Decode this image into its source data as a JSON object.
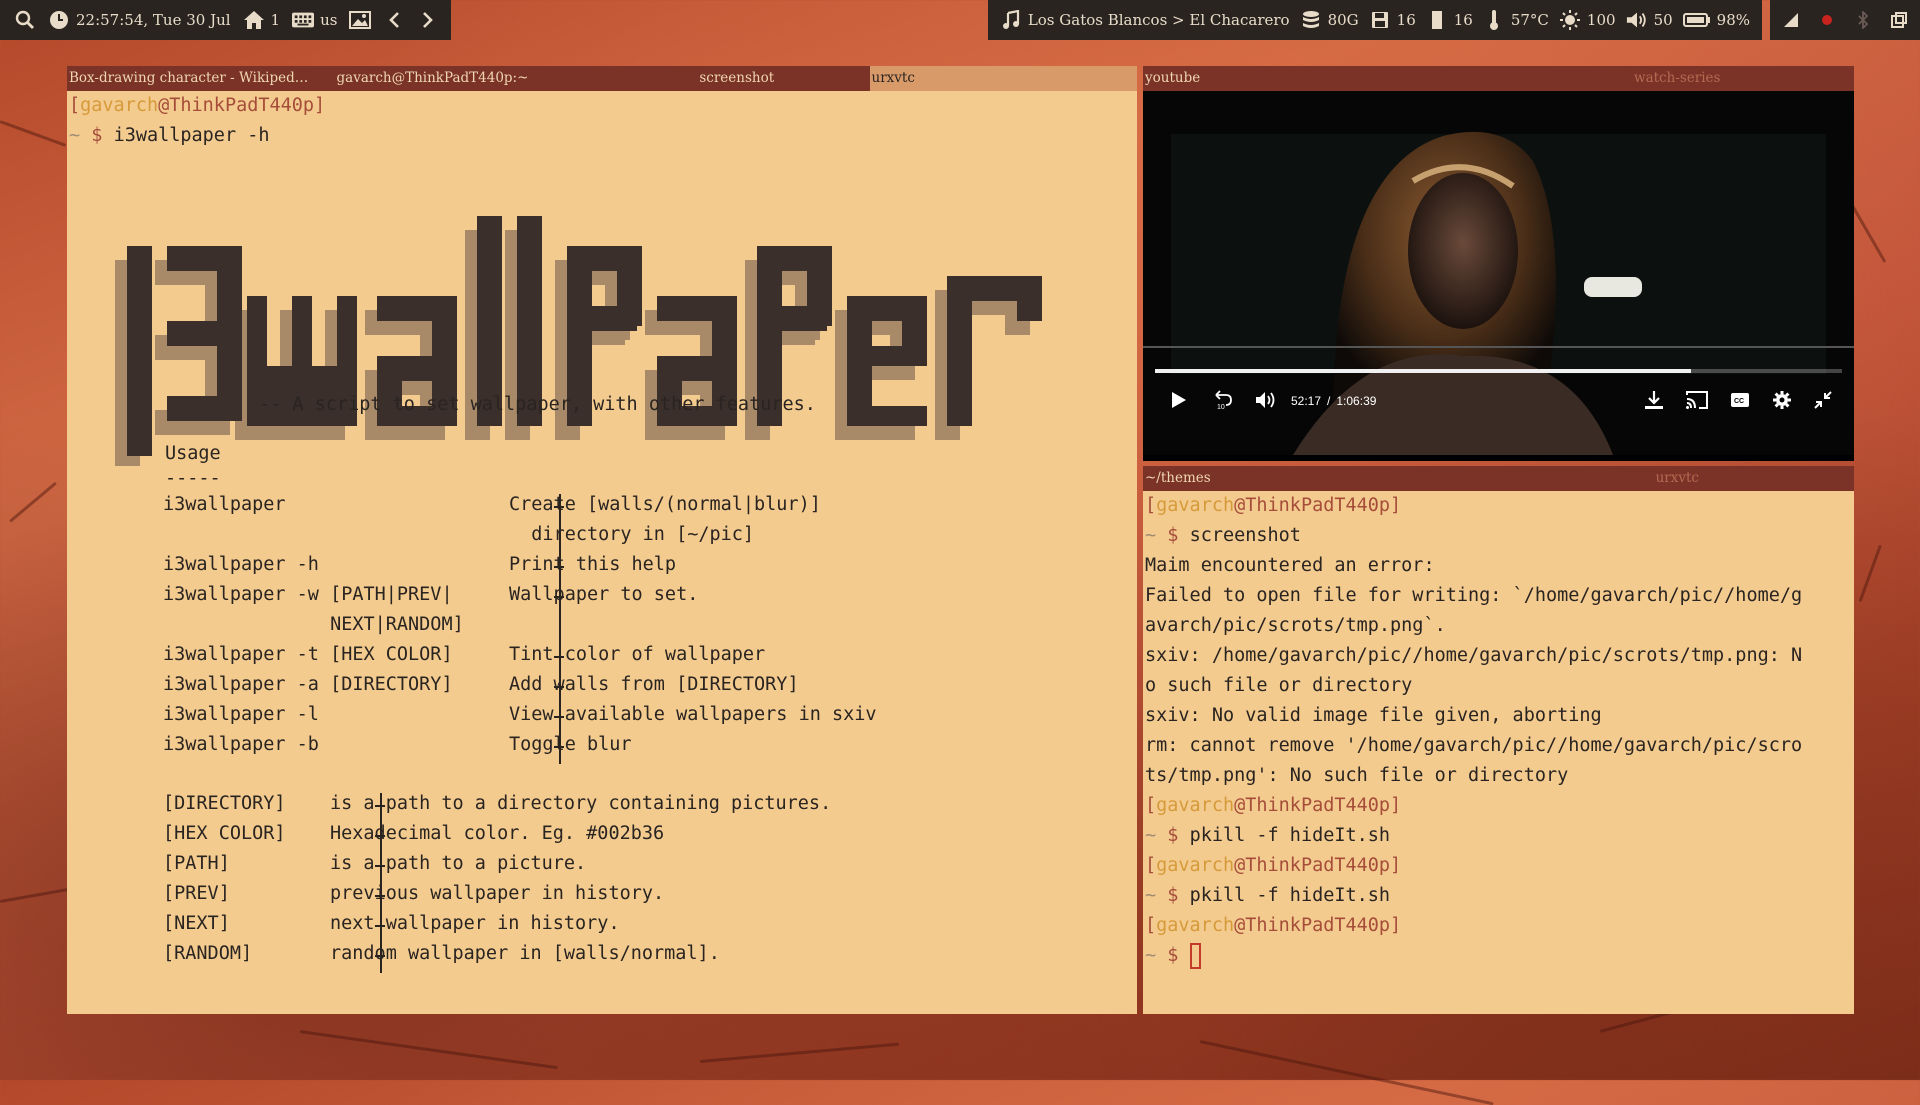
{
  "topbar": {
    "search_icon": "search-icon",
    "clock": "22:57:54, Tue 30 Jul",
    "workspace": "1",
    "keyboard_layout": "us",
    "music": "Los Gatos Blancos > El Chacarero",
    "disk": "80G",
    "save_value": "16",
    "memory_value": "16",
    "temperature": "57°C",
    "brightness": "100",
    "volume": "50",
    "battery": "98%"
  },
  "left_window": {
    "tabs": [
      "Box-drawing character - Wikiped…",
      "gavarch@ThinkPadT440p:~",
      "screenshot",
      "urxvtc"
    ],
    "prompt": {
      "open": "[",
      "user": "gavarch",
      "at": "@",
      "host": "ThinkPadT440p",
      "close": "]"
    },
    "command_line": {
      "tilde": "~",
      "dollar": "$",
      "command": "i3wallpaper -h"
    },
    "tagline": "-- A script to set wallpaper, with other features.",
    "usage_title": "Usage",
    "usage_rule": "-----",
    "usage_rows": [
      {
        "cmd": "i3wallpaper",
        "desc": "Create [walls/(normal|blur)]"
      },
      {
        "cmd": "",
        "desc": "  directory in [~/pic]"
      },
      {
        "cmd": "i3wallpaper -h",
        "desc": "Print this help"
      },
      {
        "cmd": "i3wallpaper -w [PATH|PREV|",
        "desc": "Wallpaper to set."
      },
      {
        "cmd": "               NEXT|RANDOM]",
        "desc": ""
      },
      {
        "cmd": "i3wallpaper -t [HEX COLOR]",
        "desc": "Tint color of wallpaper"
      },
      {
        "cmd": "i3wallpaper -a [DIRECTORY]",
        "desc": "Add walls from [DIRECTORY]"
      },
      {
        "cmd": "i3wallpaper -l",
        "desc": "View available wallpapers in sxiv"
      },
      {
        "cmd": "i3wallpaper -b",
        "desc": "Toggle blur"
      }
    ],
    "param_rows": [
      {
        "name": "[DIRECTORY]",
        "desc": "is a path to a directory containing pictures."
      },
      {
        "name": "[HEX COLOR]",
        "desc": "Hexadecimal color. Eg. #002b36"
      },
      {
        "name": "[PATH]",
        "desc": "is a path to a picture."
      },
      {
        "name": "[PREV]",
        "desc": "previous wallpaper in history."
      },
      {
        "name": "[NEXT]",
        "desc": "next wallpaper in history."
      },
      {
        "name": "[RANDOM]",
        "desc": "random wallpaper in [walls/normal]."
      }
    ]
  },
  "video_window": {
    "tabs": [
      "youtube",
      "watch-series"
    ],
    "current_time": "52:17",
    "separator": "/",
    "duration": "1:06:39",
    "progress": 0.78
  },
  "right_terminal": {
    "tabs": [
      "~/themes",
      "urxvtc"
    ],
    "lines": [
      {
        "type": "prompt"
      },
      {
        "type": "cmd",
        "text": "screenshot"
      },
      {
        "type": "out",
        "text": "Maim encountered an error:"
      },
      {
        "type": "out",
        "text": "Failed to open file for writing: `/home/gavarch/pic//home/g"
      },
      {
        "type": "out",
        "text": "avarch/pic/scrots/tmp.png`."
      },
      {
        "type": "out",
        "text": "sxiv: /home/gavarch/pic//home/gavarch/pic/scrots/tmp.png: N"
      },
      {
        "type": "out",
        "text": "o such file or directory"
      },
      {
        "type": "out",
        "text": "sxiv: No valid image file given, aborting"
      },
      {
        "type": "out",
        "text": "rm: cannot remove '/home/gavarch/pic//home/gavarch/pic/scro"
      },
      {
        "type": "out",
        "text": "ts/tmp.png': No such file or directory"
      },
      {
        "type": "prompt"
      },
      {
        "type": "cmd",
        "text": "pkill -f hideIt.sh"
      },
      {
        "type": "prompt"
      },
      {
        "type": "cmd",
        "text": "pkill -f hideIt.sh"
      },
      {
        "type": "prompt"
      },
      {
        "type": "cursor"
      }
    ]
  },
  "colors": {
    "terminal_bg": "#f3cb8f",
    "tabbar_bg": "#7a3326",
    "bar_bg": "#2a2421",
    "prompt_user": "#d69a3a",
    "prompt_accent": "#a64d3a"
  }
}
